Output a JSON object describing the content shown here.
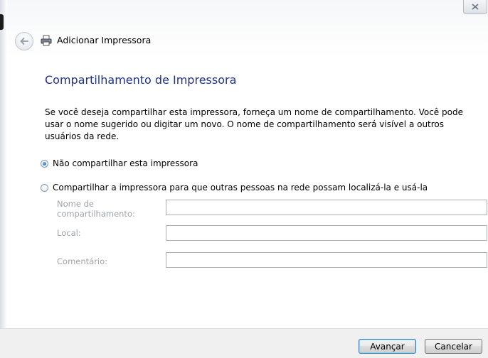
{
  "window": {
    "title": "Adicionar Impressora"
  },
  "titlebar": {
    "icons": [
      "back-arrow-icon",
      "printer-icon",
      "close-icon"
    ]
  },
  "page": {
    "heading": "Compartilhamento de Impressora",
    "description": "Se você deseja compartilhar esta impressora, forneça um nome de compartilhamento. Você pode usar o nome sugerido ou digitar um novo. O nome de compartilhamento será visível a outros usuários da rede."
  },
  "options": [
    {
      "label": "Não compartilhar esta impressora",
      "selected": true
    },
    {
      "label": "Compartilhar a impressora para que outras pessoas na rede possam localizá-la e usá-la",
      "selected": false
    }
  ],
  "fields": {
    "share_name": {
      "label": "Nome de compartilhamento:",
      "value": ""
    },
    "location": {
      "label": "Local:",
      "value": ""
    },
    "comment": {
      "label": "Comentário:",
      "value": ""
    }
  },
  "buttons": {
    "next": "Avançar",
    "cancel": "Cancelar"
  },
  "colors": {
    "heading": "#1e3287",
    "disabled_label": "#9ea3aa",
    "footer_bg": "#f0f0f0"
  }
}
